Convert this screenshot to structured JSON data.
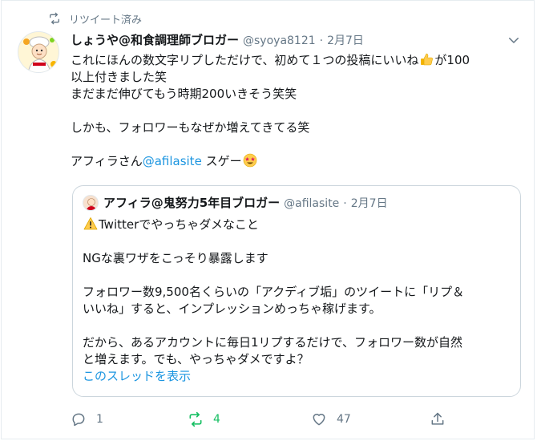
{
  "retweet_banner": {
    "label": "リツイート済み"
  },
  "tweet": {
    "author_name": "しょうや@和食調理師ブロガー",
    "author_handle": "@syoya8121",
    "separator": "·",
    "date": "2月7日",
    "lines": {
      "l1a": "これにほんの数文字リプしただけで、初めて１つの投稿にいいね",
      "l1b": "が100",
      "l2": "以上付きました笑",
      "l3": "まだまだ伸びてもう時期200いきそう笑笑",
      "l4": "しかも、フォロワーもなぜか増えてきてる笑",
      "l5a": "アフィラさん",
      "l5_mention": "@afilasite",
      "l5b": " スゲー"
    }
  },
  "quoted": {
    "author_name": "アフィラ@鬼努力5年目ブロガー",
    "author_handle": "@afilasite",
    "separator": "·",
    "date": "2月7日",
    "lines": {
      "l1": "Twitterでやっちゃダメなこと",
      "l2": "NGな裏ワザをこっそり暴露します",
      "l3": "フォロワー数9,500名くらいの「アクディブ垢」のツイートに「リプ＆",
      "l4": "いいね」すると、インプレッションめっちゃ稼げます。",
      "l5": "だから、あるアカウントに毎日1リプするだけで、フォロワー数が自然",
      "l6": "と増えます。でも、やっちゃダメですよ？"
    },
    "show_thread": "このスレッドを表示"
  },
  "actions": {
    "reply_count": "1",
    "retweet_count": "4",
    "like_count": "47"
  },
  "colors": {
    "link": "#1b95e0",
    "secondary_text": "#657786",
    "retweet_active": "#17bf63"
  }
}
